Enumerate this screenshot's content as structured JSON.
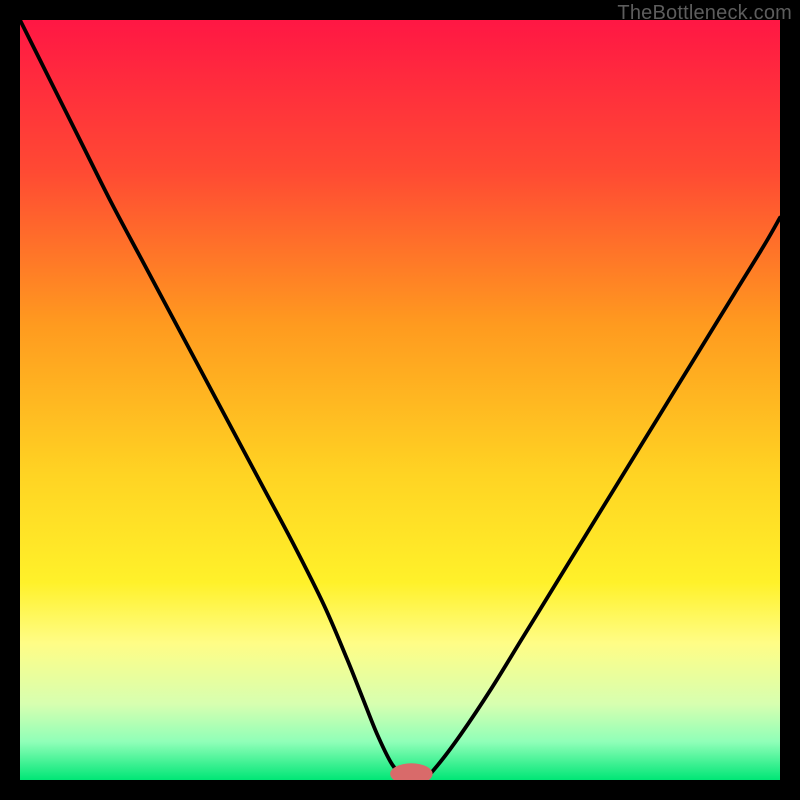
{
  "watermark": "TheBottleneck.com",
  "chart_data": {
    "type": "line",
    "title": "",
    "xlabel": "",
    "ylabel": "",
    "xlim": [
      0,
      100
    ],
    "ylim": [
      0,
      100
    ],
    "grid": false,
    "legend": false,
    "background_gradient": {
      "stops": [
        {
          "pos": 0.0,
          "color": "#ff1744"
        },
        {
          "pos": 0.2,
          "color": "#ff4a33"
        },
        {
          "pos": 0.4,
          "color": "#ff9a1f"
        },
        {
          "pos": 0.6,
          "color": "#ffd423"
        },
        {
          "pos": 0.74,
          "color": "#fff12a"
        },
        {
          "pos": 0.82,
          "color": "#fffd86"
        },
        {
          "pos": 0.9,
          "color": "#d7ffb0"
        },
        {
          "pos": 0.95,
          "color": "#8fffb8"
        },
        {
          "pos": 1.0,
          "color": "#00e676"
        }
      ]
    },
    "series": [
      {
        "name": "bottleneck-curve",
        "color": "#000000",
        "x": [
          0,
          4,
          8,
          12,
          16,
          20,
          24,
          28,
          32,
          36,
          40,
          43,
          45,
          47,
          49,
          51,
          53,
          55,
          58,
          62,
          66,
          70,
          74,
          78,
          82,
          86,
          90,
          94,
          98,
          100
        ],
        "y": [
          100,
          92,
          84,
          76,
          68.5,
          61,
          53.5,
          46,
          38.5,
          31,
          23,
          16,
          11,
          6,
          2,
          0,
          0,
          2,
          6,
          12,
          18.5,
          25,
          31.5,
          38,
          44.5,
          51,
          57.5,
          64,
          70.5,
          74
        ]
      }
    ],
    "marker": {
      "name": "optimal-point",
      "x": 51.5,
      "y": 0.8,
      "color": "#d96a6a",
      "rx": 2.8,
      "ry": 1.4
    }
  }
}
